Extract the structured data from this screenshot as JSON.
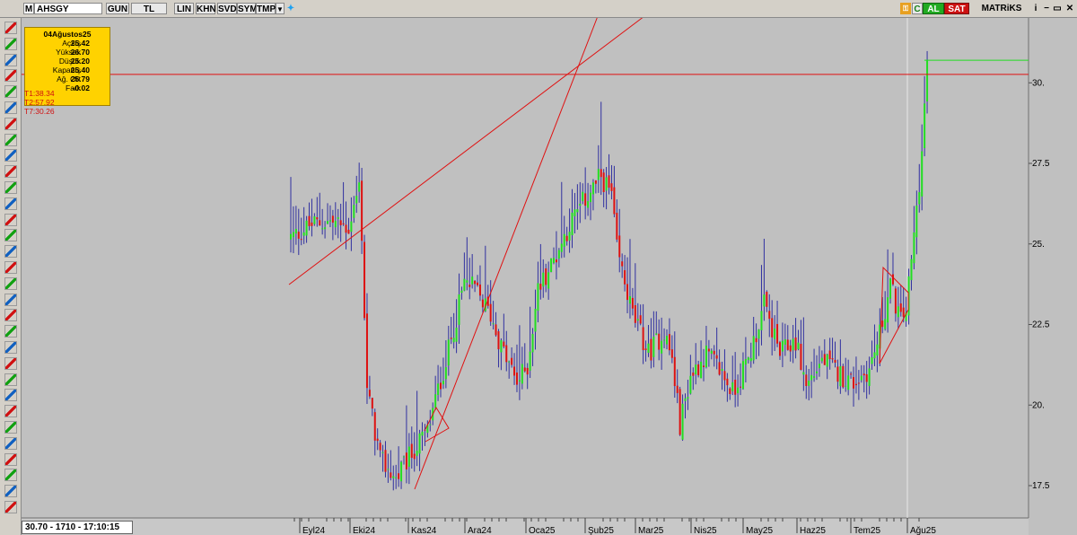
{
  "toolbar": {
    "menu_letter": "M",
    "symbol": "AHSGY",
    "buttons": [
      "GUN",
      "TL",
      "LIN",
      "KHN",
      "SVD",
      "SYM",
      "TMP"
    ],
    "buy_label": "AL",
    "sell_label": "SAT",
    "brand": "MATRiKS"
  },
  "info_box": {
    "date": "04Ağustos25",
    "rows": [
      {
        "label": "Açılış",
        "value": "25.42"
      },
      {
        "label": "Yüksek",
        "value": "26.70"
      },
      {
        "label": "Düşük",
        "value": "25.20"
      },
      {
        "label": "Kapanış",
        "value": "25.40"
      },
      {
        "label": "Ağ. Ort",
        "value": "25.79"
      },
      {
        "label": "Fark",
        "value": "-0.02"
      }
    ],
    "t_lines": [
      "T1:38.34",
      "T2:57.92",
      "T7:30.26"
    ]
  },
  "status": "30.70 - 1710 - 17:10:15",
  "colors": {
    "up": "#22dd22",
    "down": "#dd1111",
    "neutral": "#3030a0",
    "drawing": "#e01010",
    "accent": "#ffd200"
  },
  "chart_data": {
    "type": "candlestick",
    "ylim": [
      16.9,
      31.7
    ],
    "yticks": [
      "17.5",
      "20.",
      "22.5",
      "25.",
      "27.5",
      "30."
    ],
    "ytick_values": [
      17.5,
      20,
      22.5,
      25,
      27.5,
      30
    ],
    "x_labels": [
      "Eyl24",
      "Eki24",
      "Kas24",
      "Ara24",
      "Oca25",
      "Şub25",
      "Mar25",
      "Nis25",
      "May25",
      "Haz25",
      "Tem25",
      "Ağu25"
    ],
    "horizontal_line": 30.26,
    "last_price": 30.7,
    "price_anchors": [
      [
        0,
        25.2
      ],
      [
        8,
        25.6
      ],
      [
        15,
        25.7
      ],
      [
        22,
        25.5
      ],
      [
        26,
        26.8
      ],
      [
        27,
        25.3
      ],
      [
        28,
        22.8
      ],
      [
        29,
        20.5
      ],
      [
        34,
        18.3
      ],
      [
        40,
        17.7
      ],
      [
        46,
        18.5
      ],
      [
        52,
        19.2
      ],
      [
        60,
        21.7
      ],
      [
        66,
        23.8
      ],
      [
        70,
        23.6
      ],
      [
        76,
        22.8
      ],
      [
        80,
        21.8
      ],
      [
        86,
        20.7
      ],
      [
        90,
        21.2
      ],
      [
        94,
        23.6
      ],
      [
        100,
        24.5
      ],
      [
        106,
        25.6
      ],
      [
        112,
        26.4
      ],
      [
        118,
        27.1
      ],
      [
        122,
        26.5
      ],
      [
        124,
        24.8
      ],
      [
        130,
        22.8
      ],
      [
        136,
        21.6
      ],
      [
        142,
        22.3
      ],
      [
        145,
        21.4
      ],
      [
        148,
        19.4
      ],
      [
        152,
        20.9
      ],
      [
        158,
        21.6
      ],
      [
        164,
        21.0
      ],
      [
        168,
        20.4
      ],
      [
        174,
        21.4
      ],
      [
        180,
        23.1
      ],
      [
        186,
        21.6
      ],
      [
        192,
        22.0
      ],
      [
        196,
        20.6
      ],
      [
        202,
        21.4
      ],
      [
        208,
        21.0
      ],
      [
        214,
        20.7
      ],
      [
        220,
        21.1
      ],
      [
        224,
        22.2
      ],
      [
        228,
        23.7
      ],
      [
        232,
        22.6
      ],
      [
        234,
        23.0
      ],
      [
        236,
        24.4
      ],
      [
        238,
        26.1
      ],
      [
        240,
        27.8
      ],
      [
        242,
        30.7
      ]
    ]
  }
}
